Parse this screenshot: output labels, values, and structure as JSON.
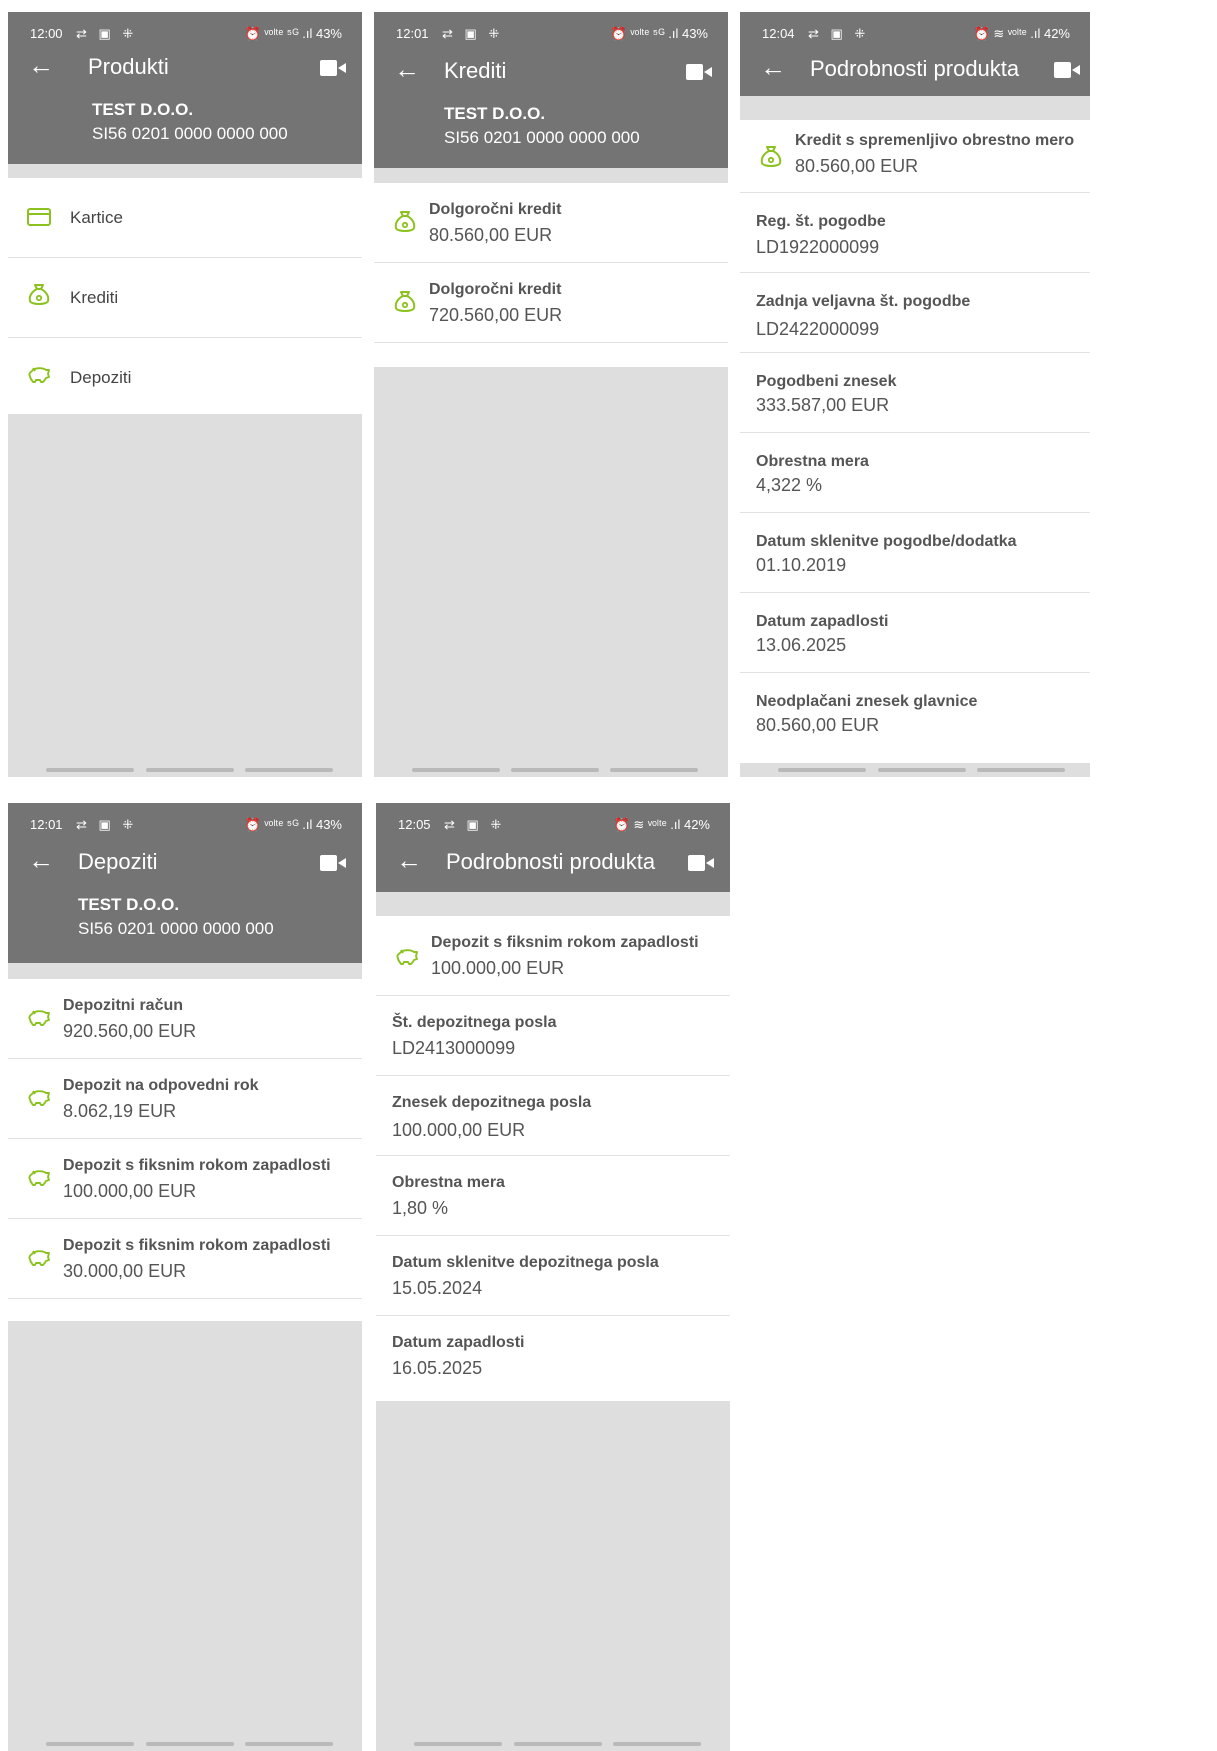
{
  "colors": {
    "header": "#747474",
    "accent": "#8cc21f",
    "gap": "#dedede"
  },
  "screens": [
    {
      "status": {
        "time": "12:00",
        "left": "⇄ ▣ ⁜",
        "right": "⏰ ᵛᵒˡᵗᵉ ⁵ᴳ .ıl 43%"
      },
      "title": "Produkti",
      "company": {
        "name": "TEST D.O.O.",
        "iban": "SI56 0201 0000 0000 000"
      },
      "rows": [
        {
          "label": "Kartice",
          "icon": "card-icon"
        },
        {
          "label": "Krediti",
          "icon": "money-bag-icon"
        },
        {
          "label": "Depoziti",
          "icon": "piggy-bank-icon"
        }
      ]
    },
    {
      "status": {
        "time": "12:01",
        "left": "⇄ ▣ ⁜",
        "right": "⏰ ᵛᵒˡᵗᵉ ⁵ᴳ .ıl 43%"
      },
      "title": "Krediti",
      "company": {
        "name": "TEST D.O.O.",
        "iban": "SI56 0201 0000 0000 000"
      },
      "items": [
        {
          "name": "Dolgoročni kredit",
          "value": "80.560,00 EUR",
          "icon": "money-bag-icon"
        },
        {
          "name": "Dolgoročni kredit",
          "value": "720.560,00 EUR",
          "icon": "money-bag-icon"
        }
      ]
    },
    {
      "status": {
        "time": "12:04",
        "left": "⇄ ▣ ⁜",
        "right": "⏰ ≋ ᵛᵒˡᵗᵉ .ıl 42%"
      },
      "title": "Podrobnosti produkta",
      "product": {
        "name": "Kredit s spremenljivo obrestno mero",
        "value": "80.560,00 EUR",
        "icon": "money-bag-icon"
      },
      "details": [
        {
          "k": "Reg. št. pogodbe",
          "v": "LD1922000099"
        },
        {
          "k": "Zadnja veljavna št. pogodbe",
          "v": "LD2422000099"
        },
        {
          "k": "Pogodbeni znesek",
          "v": "333.587,00 EUR"
        },
        {
          "k": "Obrestna mera",
          "v": "4,322 %"
        },
        {
          "k": "Datum sklenitve pogodbe/dodatka",
          "v": "01.10.2019"
        },
        {
          "k": "Datum zapadlosti",
          "v": "13.06.2025"
        },
        {
          "k": "Neodplačani znesek glavnice",
          "v": "80.560,00 EUR"
        }
      ]
    },
    {
      "status": {
        "time": "12:01",
        "left": "⇄ ▣ ⁜",
        "right": "⏰ ᵛᵒˡᵗᵉ ⁵ᴳ .ıl 43%"
      },
      "title": "Depoziti",
      "company": {
        "name": "TEST D.O.O.",
        "iban": "SI56 0201 0000 0000 000"
      },
      "items": [
        {
          "name": "Depozitni račun",
          "value": "920.560,00 EUR",
          "icon": "piggy-bank-icon"
        },
        {
          "name": "Depozit na odpovedni rok",
          "value": "8.062,19 EUR",
          "icon": "piggy-bank-icon"
        },
        {
          "name": "Depozit s fiksnim rokom zapadlosti",
          "value": "100.000,00 EUR",
          "icon": "piggy-bank-icon"
        },
        {
          "name": "Depozit s fiksnim rokom zapadlosti",
          "value": "30.000,00 EUR",
          "icon": "piggy-bank-icon"
        }
      ]
    },
    {
      "status": {
        "time": "12:05",
        "left": "⇄ ▣ ⁜",
        "right": "⏰ ≋ ᵛᵒˡᵗᵉ .ıl 42%"
      },
      "title": "Podrobnosti produkta",
      "product": {
        "name": "Depozit s fiksnim rokom zapadlosti",
        "value": "100.000,00 EUR",
        "icon": "piggy-bank-icon"
      },
      "details": [
        {
          "k": "Št. depozitnega posla",
          "v": "LD2413000099"
        },
        {
          "k": "Znesek depozitnega posla",
          "v": "100.000,00 EUR"
        },
        {
          "k": "Obrestna mera",
          "v": "1,80 %"
        },
        {
          "k": "Datum sklenitve depozitnega posla",
          "v": "15.05.2024"
        },
        {
          "k": "Datum zapadlosti",
          "v": "16.05.2025"
        }
      ]
    }
  ]
}
